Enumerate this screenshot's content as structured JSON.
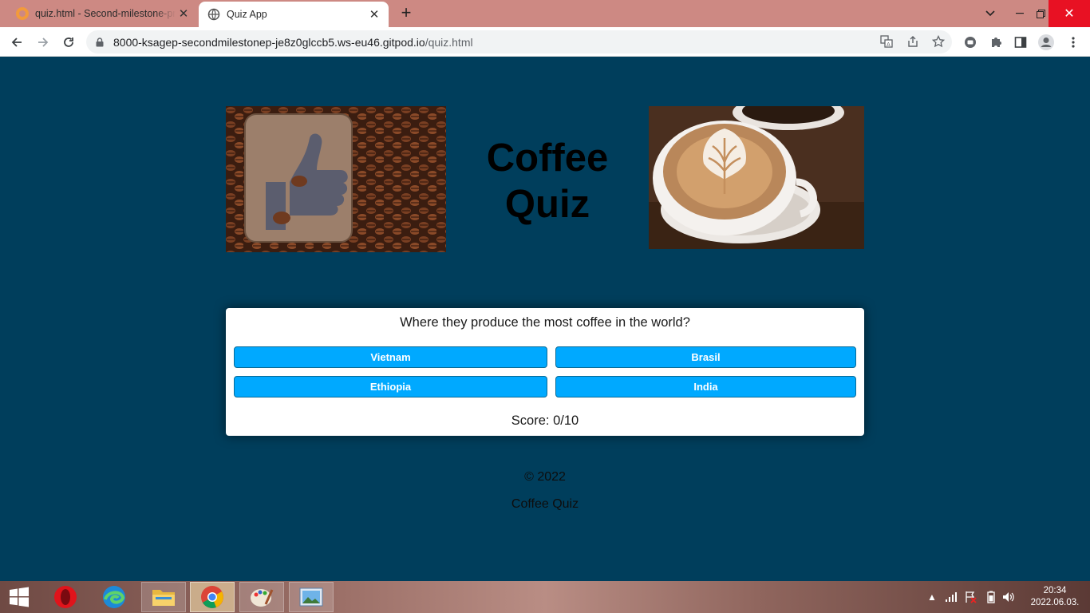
{
  "browser": {
    "tabs": [
      {
        "title": "quiz.html - Second-milestone-project"
      },
      {
        "title": "Quiz App"
      }
    ],
    "url_host": "8000-ksagep-secondmilestonep-je8z0glccb5.ws-eu46.gitpod.io",
    "url_path": "/quiz.html"
  },
  "page": {
    "heading": "Coffee Quiz",
    "images": {
      "left": "coffee-beans-thumbs-up-image",
      "right": "latte-art-cup-image"
    },
    "quiz": {
      "question": "Where they produce the most coffee in the world?",
      "answers": [
        "Vietnam",
        "Brasil",
        "Ethiopia",
        "India"
      ],
      "score": "Score: 0/10"
    },
    "footer": {
      "copyright": "© 2022",
      "name": "Coffee Quiz"
    },
    "colors": {
      "background": "#003e5c",
      "answer_button": "#00a9ff",
      "card": "#ffffff"
    }
  },
  "taskbar": {
    "apps": [
      "opera-icon",
      "edge-icon",
      "file-explorer-icon",
      "chrome-icon",
      "paint-icon",
      "photos-icon"
    ],
    "time": "20:34",
    "date": "2022.06.03."
  }
}
